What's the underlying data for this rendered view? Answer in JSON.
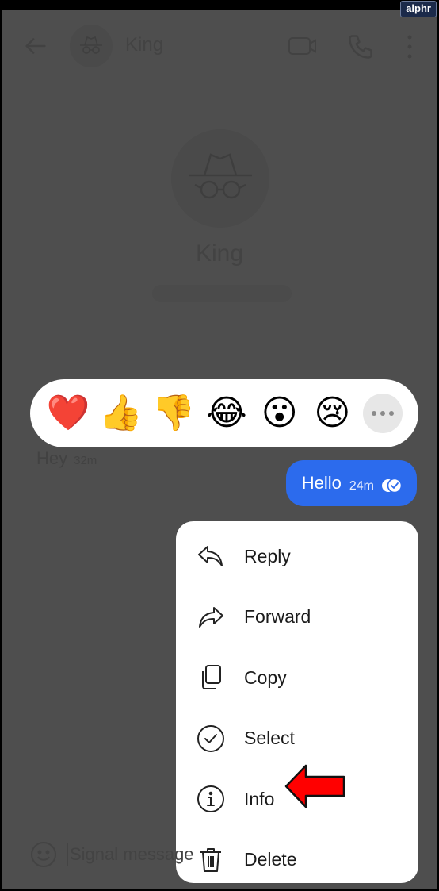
{
  "watermark": "alphr",
  "header": {
    "contact_name": "King",
    "icons": [
      "back-arrow-icon",
      "incognito-avatar-icon",
      "video-call-icon",
      "phone-icon",
      "more-vertical-icon"
    ]
  },
  "profile": {
    "name": "King"
  },
  "reactions": {
    "items": [
      {
        "name": "heart",
        "glyph": "❤️"
      },
      {
        "name": "thumbs-up",
        "glyph": "👍"
      },
      {
        "name": "thumbs-down",
        "glyph": "👎"
      },
      {
        "name": "tears-of-joy",
        "glyph": "😂"
      },
      {
        "name": "surprised",
        "glyph": "😮"
      },
      {
        "name": "crying",
        "glyph": "😢"
      }
    ],
    "more_icon": "more-horizontal-icon"
  },
  "messages": {
    "incoming": {
      "text": "Hey",
      "time": "32m"
    },
    "outgoing": {
      "text": "Hello",
      "time": "24m",
      "status_icon": "delivered-check-icon",
      "color": "#2c6bed"
    }
  },
  "menu": {
    "items": [
      {
        "label": "Reply",
        "icon": "reply-icon"
      },
      {
        "label": "Forward",
        "icon": "forward-icon"
      },
      {
        "label": "Copy",
        "icon": "copy-icon"
      },
      {
        "label": "Select",
        "icon": "select-check-icon"
      },
      {
        "label": "Info",
        "icon": "info-icon"
      },
      {
        "label": "Delete",
        "icon": "trash-icon"
      }
    ]
  },
  "composer": {
    "placeholder": "Signal message"
  },
  "annotation": {
    "arrow_color": "#ff0000",
    "points_to": "Info"
  }
}
